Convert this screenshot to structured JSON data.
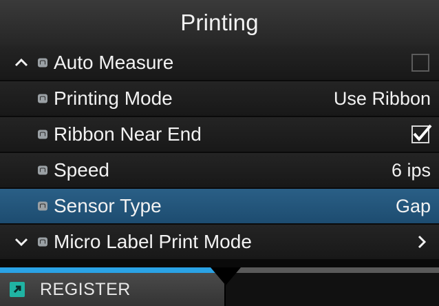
{
  "header": {
    "title": "Printing"
  },
  "menu": {
    "items": [
      {
        "label": "Auto Measure",
        "value": "",
        "control": "checkbox",
        "checked": false,
        "nav": "up-arrow-icon",
        "selected": false
      },
      {
        "label": "Printing Mode",
        "value": "Use Ribbon",
        "control": "value",
        "selected": false
      },
      {
        "label": "Ribbon Near End",
        "value": "",
        "control": "checkbox",
        "checked": true,
        "selected": false
      },
      {
        "label": "Speed",
        "value": "6 ips",
        "control": "value",
        "selected": false
      },
      {
        "label": "Sensor Type",
        "value": "Gap",
        "control": "value",
        "selected": true
      },
      {
        "label": "Micro Label Print Mode",
        "value": "",
        "control": "submenu",
        "nav": "down-arrow-icon",
        "selected": false
      }
    ]
  },
  "footer": {
    "register_label": "REGISTER",
    "register_icon": "register-icon",
    "scroll_progress": 0.5
  },
  "colors": {
    "selected_row": "#1d4c70",
    "progress": "#2aa3e6",
    "register_icon": "#20b3a3",
    "lock_icon": "#9aa0a4"
  }
}
